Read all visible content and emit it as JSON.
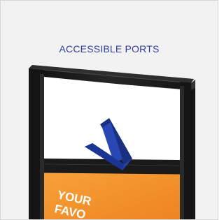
{
  "headline": "ACCESSIBLE PORTS",
  "graphic": {
    "icon": "down-arrow-icon",
    "sign_text": [
      "YOUR",
      "FAVO"
    ],
    "colors": {
      "headline": "#2f3c9f",
      "arrow": "#1f3a9b",
      "frame": "#1c1c1c",
      "sign": "#f3922b"
    }
  }
}
